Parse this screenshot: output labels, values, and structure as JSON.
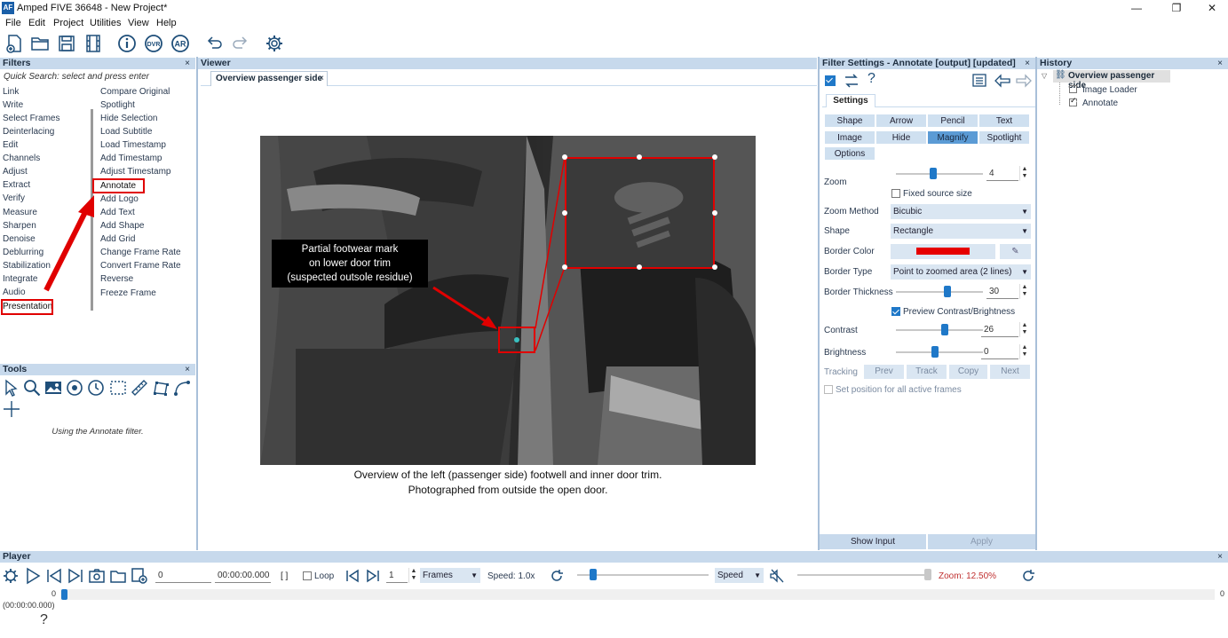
{
  "window": {
    "title": "Amped FIVE 36648 - New Project*",
    "app_icon_text": "AF",
    "minimize": "—",
    "maximize": "❐",
    "close": "✕"
  },
  "menu": [
    "File",
    "Edit",
    "Project",
    "Utilities",
    "View",
    "Help"
  ],
  "toolbar_icons": [
    "new-project-icon",
    "open-folder-icon",
    "save-icon",
    "film-icon",
    "info-icon",
    "dvr-icon",
    "ar-icon",
    "undo-icon",
    "redo-icon",
    "settings-icon"
  ],
  "filters": {
    "header": "Filters",
    "close": "×",
    "search_placeholder": "Quick Search: select and press enter",
    "categories": [
      "Link",
      "Write",
      "Select Frames",
      "Deinterlacing",
      "Edit",
      "Channels",
      "Adjust",
      "Extract",
      "Verify",
      "Measure",
      "Sharpen",
      "Denoise",
      "Deblurring",
      "Stabilization",
      "Integrate",
      "Audio",
      "Presentation"
    ],
    "items": [
      "Compare Original",
      "Spotlight",
      "Hide Selection",
      "Load Subtitle",
      "Load Timestamp",
      "Add Timestamp",
      "Adjust Timestamp",
      "Annotate",
      "Add Logo",
      "Add Text",
      "Add Shape",
      "Add Grid",
      "Change Frame Rate",
      "Convert Frame Rate",
      "Reverse",
      "Freeze Frame"
    ]
  },
  "tools": {
    "header": "Tools",
    "close": "×",
    "status": "Using the Annotate filter."
  },
  "viewer": {
    "header": "Viewer",
    "tab": "Overview passenger side",
    "tab_close": "×",
    "callout_lines": [
      "Partial footwear mark",
      "on lower door trim",
      "(suspected outsole residue)"
    ],
    "caption_lines": [
      "Overview of the left (passenger side) footwell and inner door trim.",
      "Photographed from outside the open door."
    ]
  },
  "filter_settings": {
    "header": "Filter Settings - Annotate [output] [updated]",
    "close": "×",
    "help": "?",
    "tab": "Settings",
    "shape_tabs": [
      "Shape",
      "Arrow",
      "Pencil",
      "Text",
      "Image",
      "Hide",
      "Magnify",
      "Spotlight",
      "Options"
    ],
    "selected_tab": "Magnify",
    "zoom_label": "Zoom",
    "zoom_value": "4",
    "fixed_source_size": "Fixed source size",
    "zoom_method_label": "Zoom Method",
    "zoom_method": "Bicubic",
    "shape_label": "Shape",
    "shape": "Rectangle",
    "border_color_label": "Border Color",
    "border_color": "#e60000",
    "border_type_label": "Border Type",
    "border_type": "Point to zoomed area (2 lines)",
    "border_thickness_label": "Border Thickness",
    "border_thickness": "30",
    "preview_label": "Preview Contrast/Brightness",
    "contrast_label": "Contrast",
    "contrast": "26",
    "brightness_label": "Brightness",
    "brightness": "0",
    "tracking_label": "Tracking",
    "tracking_buttons": [
      "Prev",
      "Track",
      "Copy",
      "Next"
    ],
    "set_position": "Set position for all active frames",
    "show_input": "Show Input",
    "apply": "Apply"
  },
  "history": {
    "header": "History",
    "close": "×",
    "root": "Overview passenger side",
    "children": [
      "Image Loader",
      "Annotate"
    ]
  },
  "player": {
    "header": "Player",
    "close": "×",
    "frame": "0",
    "time": "00:00:00.000",
    "brackets": "[ ]",
    "loop": "Loop",
    "step": "1",
    "unit": "Frames",
    "speed": "Speed: 1.0x",
    "speed_mode": "Speed",
    "zoom": "Zoom: 12.50%",
    "timeline_start": "0",
    "timeline_end": "0",
    "time_display": "(00:00:00.000)",
    "help": "?"
  }
}
